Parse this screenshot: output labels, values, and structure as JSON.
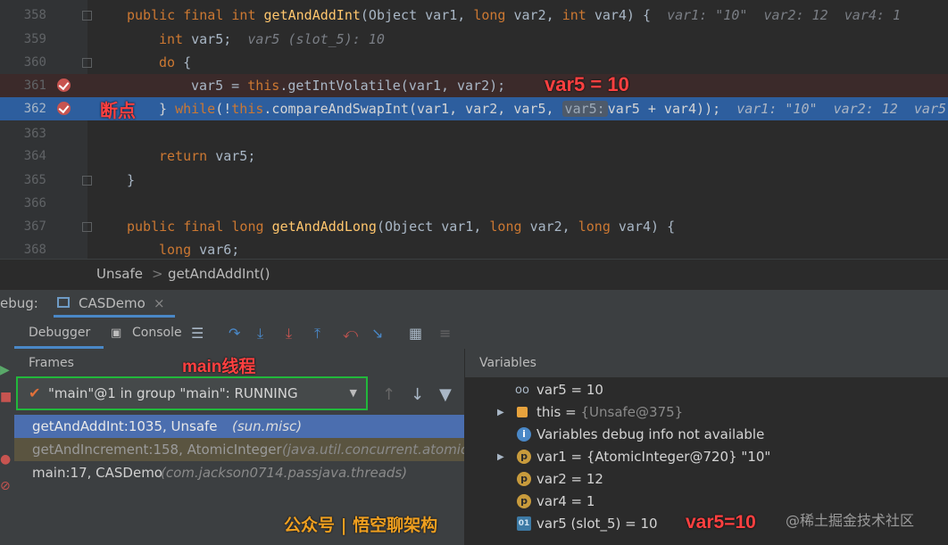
{
  "editor": {
    "lines": [
      {
        "num": "358"
      },
      {
        "num": "359"
      },
      {
        "num": "360"
      },
      {
        "num": "361"
      },
      {
        "num": "362"
      },
      {
        "num": "363"
      },
      {
        "num": "364"
      },
      {
        "num": "365"
      },
      {
        "num": "366"
      },
      {
        "num": "367"
      },
      {
        "num": "368"
      }
    ],
    "hints": {
      "l358": "var1: \"10\"  var2: 12  var4: 1",
      "l359": "var5 (slot_5): 10",
      "l362": "var1: \"10\"  var2: 12  var5",
      "inlay": "var5:"
    },
    "annotations": {
      "breakpoint_label": "断点",
      "var5_label": "var5 = 10"
    }
  },
  "breadcrumb": {
    "class": "Unsafe",
    "separator": ">",
    "method": "getAndAddInt()"
  },
  "debug": {
    "title": "ebug:",
    "session_tab": "CASDemo",
    "tabs": {
      "debugger": "Debugger",
      "console": "Console"
    },
    "frames_header": "Frames",
    "variables_header": "Variables",
    "thread_annotation": "main线程",
    "thread_select": "\"main\"@1 in group \"main\": RUNNING",
    "frames": [
      {
        "method": "getAndAddInt:1035, Unsafe",
        "pkg": "(sun.misc)"
      },
      {
        "method": "getAndIncrement:158, AtomicInteger",
        "pkg": "(java.util.concurrent.atomic)"
      },
      {
        "method": "main:17, CASDemo",
        "pkg": "(com.jackson0714.passjava.threads)"
      }
    ],
    "variables": [
      {
        "name": "var5",
        "eq": " = ",
        "value": "10"
      },
      {
        "name": "this",
        "eq": " = ",
        "value": "{Unsafe@375}"
      },
      {
        "name": "Variables debug info not available",
        "eq": "",
        "value": ""
      },
      {
        "name": "var1",
        "eq": " = ",
        "value": "{AtomicInteger@720} \"10\""
      },
      {
        "name": "var2",
        "eq": " = ",
        "value": "12"
      },
      {
        "name": "var4",
        "eq": " = ",
        "value": "1"
      },
      {
        "name": "var5 (slot_5)",
        "eq": " = ",
        "value": "10"
      }
    ],
    "var_annotation": "var5=10",
    "watermark_left": "公众号 | 悟空聊架构",
    "watermark_right": "@稀土掘金技术社区"
  },
  "colors": {
    "editor_bg": "#2b2b2b",
    "execution_line": "#2d5e9e",
    "breakpoint_line": "#3b2a2a",
    "annotation_red": "#ff4040",
    "thread_border": "#21b83b"
  }
}
